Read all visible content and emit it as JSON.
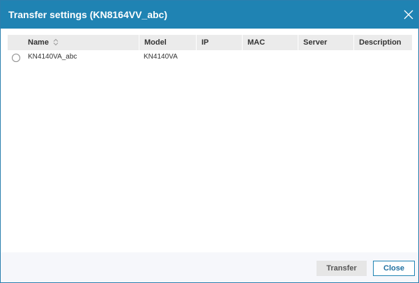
{
  "dialog": {
    "title": "Transfer settings (KN8164VV_abc)",
    "close_icon": "close-icon",
    "accent_color": "#1f83b3"
  },
  "table": {
    "columns": [
      "Name",
      "Model",
      "IP",
      "MAC",
      "Server",
      "Description"
    ],
    "sort_icon": "sort-icon",
    "rows": [
      {
        "selected": false,
        "name": "KN4140VA_abc",
        "model": "KN4140VA",
        "ip": "",
        "mac": "",
        "server": "",
        "description": ""
      }
    ]
  },
  "footer": {
    "transfer_label": "Transfer",
    "close_label": "Close"
  }
}
